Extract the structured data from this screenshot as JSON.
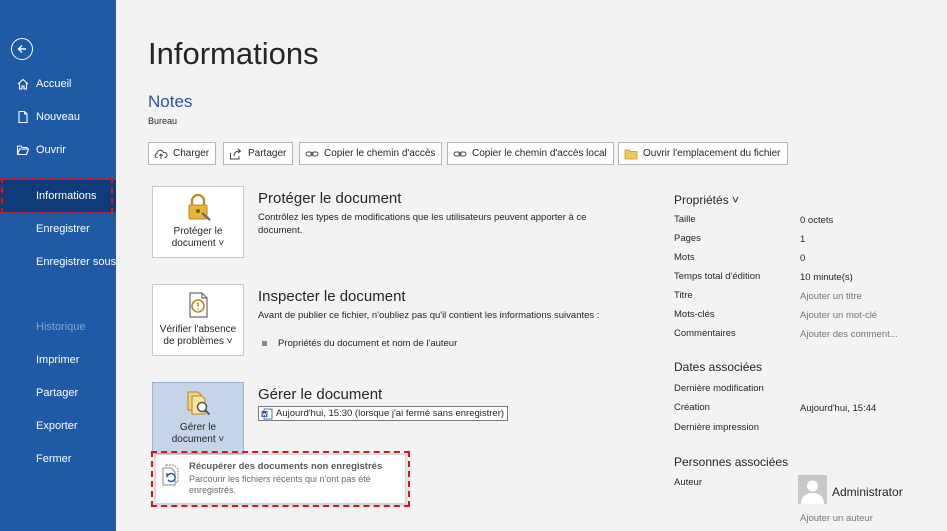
{
  "sidebar": {
    "back_icon": "back-arrow-icon",
    "items": [
      {
        "label": "Accueil",
        "icon": "home-icon"
      },
      {
        "label": "Nouveau",
        "icon": "new-document-icon"
      },
      {
        "label": "Ouvrir",
        "icon": "open-folder-icon"
      },
      {
        "label": "Informations"
      },
      {
        "label": "Enregistrer"
      },
      {
        "label": "Enregistrer sous"
      },
      {
        "label": "Historique"
      },
      {
        "label": "Imprimer"
      },
      {
        "label": "Partager"
      },
      {
        "label": "Exporter"
      },
      {
        "label": "Fermer"
      }
    ],
    "active_item": "Informations",
    "disabled_item": "Historique"
  },
  "header": {
    "title": "Informations",
    "doc_name": "Notes",
    "doc_location": "Bureau"
  },
  "toolbar": {
    "upload": "Charger",
    "share": "Partager",
    "copy_path": "Copier le chemin d'accès",
    "copy_local_path": "Copier le chemin d'accès local",
    "open_location": "Ouvrir l'emplacement du fichier"
  },
  "protect": {
    "button_line1": "Protéger le",
    "button_line2": "document ˅",
    "title": "Protéger le document",
    "description": "Contrôlez les types de modifications que les utilisateurs peuvent apporter à ce document."
  },
  "inspect": {
    "button_line1": "Vérifier l'absence",
    "button_line2": "de problèmes ˅",
    "title": "Inspecter le document",
    "description": "Avant de publier ce fichier, n'oubliez pas qu'il contient les informations suivantes :",
    "bullet": "Propriétés du document et nom de l'auteur"
  },
  "manage": {
    "button_line1": "Gérer le",
    "button_line2": "document ˅",
    "title": "Gérer le document",
    "version": "Aujourd'hui, 15:30 (lorsque j'ai fermé sans enregistrer)"
  },
  "recover": {
    "title": "Récupérer des documents non enregistrés",
    "description": "Parcourir les fichiers récents qui n'ont pas été enregistrés."
  },
  "properties": {
    "heading": "Propriétés ˅",
    "rows": [
      {
        "label": "Taille",
        "value": "0 octets"
      },
      {
        "label": "Pages",
        "value": "1"
      },
      {
        "label": "Mots",
        "value": "0"
      },
      {
        "label": "Temps total d'édition",
        "value": "10 minute(s)"
      },
      {
        "label": "Titre",
        "value": "Ajouter un titre"
      },
      {
        "label": "Mots-clés",
        "value": "Ajouter un mot-clé"
      },
      {
        "label": "Commentaires",
        "value": "Ajouter des comment..."
      }
    ]
  },
  "dates": {
    "heading": "Dates associées",
    "rows": [
      {
        "label": "Dernière modification",
        "value": ""
      },
      {
        "label": "Création",
        "value": "Aujourd'hui, 15:44"
      },
      {
        "label": "Dernière impression",
        "value": ""
      }
    ]
  },
  "people": {
    "heading": "Personnes associées",
    "author_label": "Auteur",
    "author_name": "Administrator",
    "add_author": "Ajouter un auteur"
  },
  "colors": {
    "sidebar": "#1f5aa6",
    "sidebar_active": "#0e3c7a",
    "highlight": "#d9141b",
    "accent_text": "#2b579a"
  }
}
